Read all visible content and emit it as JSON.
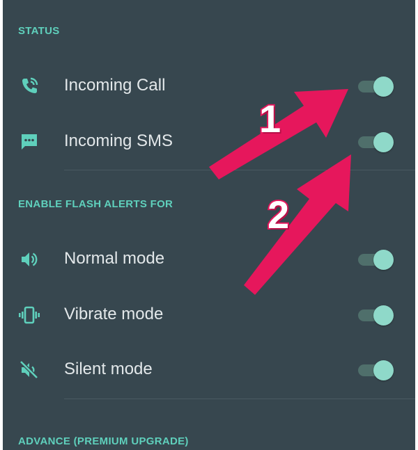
{
  "sections": {
    "status": "STATUS",
    "flash": "ENABLE FLASH ALERTS FOR",
    "advance": "ADVANCE (PREMIUM UPGRADE)"
  },
  "rows": {
    "incoming_call": {
      "label": "Incoming Call",
      "icon": "phone-ring-icon",
      "enabled": true
    },
    "incoming_sms": {
      "label": "Incoming SMS",
      "icon": "sms-icon",
      "enabled": true
    },
    "normal_mode": {
      "label": "Normal mode",
      "icon": "speaker-icon",
      "enabled": true
    },
    "vibrate_mode": {
      "label": "Vibrate mode",
      "icon": "vibrate-icon",
      "enabled": true
    },
    "silent_mode": {
      "label": "Silent mode",
      "icon": "mute-icon",
      "enabled": true
    }
  },
  "annotations": {
    "arrow1": "1",
    "arrow2": "2"
  },
  "colors": {
    "background": "#37474f",
    "accent": "#5fd0bc",
    "switch_thumb": "#8fd9c9",
    "switch_track": "#4f6f6b",
    "annotation_arrow": "#e6175c"
  }
}
